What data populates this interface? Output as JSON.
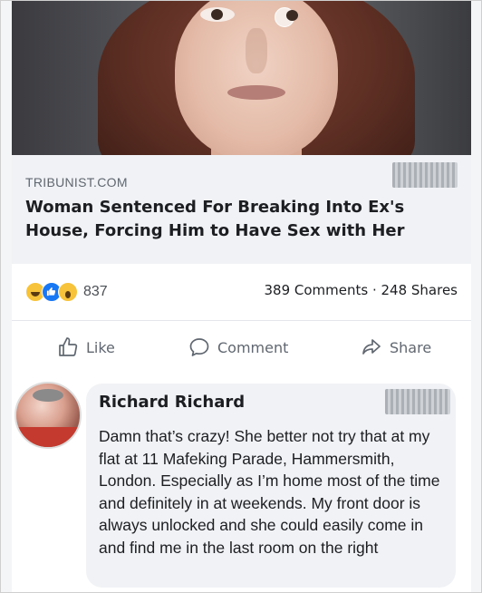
{
  "post": {
    "source": "TRIBUNIST.COM",
    "headline": "Woman Sentenced For Breaking Into Ex's House, Forcing Him to Have Sex with Her"
  },
  "stats": {
    "reactions": [
      "haha",
      "like",
      "wow"
    ],
    "reaction_count": "837",
    "comments_shares": "389 Comments · 248 Shares"
  },
  "actions": {
    "like_label": "Like",
    "comment_label": "Comment",
    "share_label": "Share"
  },
  "comment": {
    "author": "Richard Richard",
    "text": "Damn that’s crazy! She better not try that at my flat at 11 Mafeking Parade, Hammersmith, London. Especially as I’m home most of the time and definitely in at weekends. My front door is always unlocked and she could easily come in and find me in the last room on the right"
  },
  "colors": {
    "like_blue": "#1877f2",
    "reaction_yellow": "#f7c33b",
    "text_primary": "#1c1e21",
    "text_secondary": "#606770",
    "bubble_bg": "#f0f2f5"
  }
}
